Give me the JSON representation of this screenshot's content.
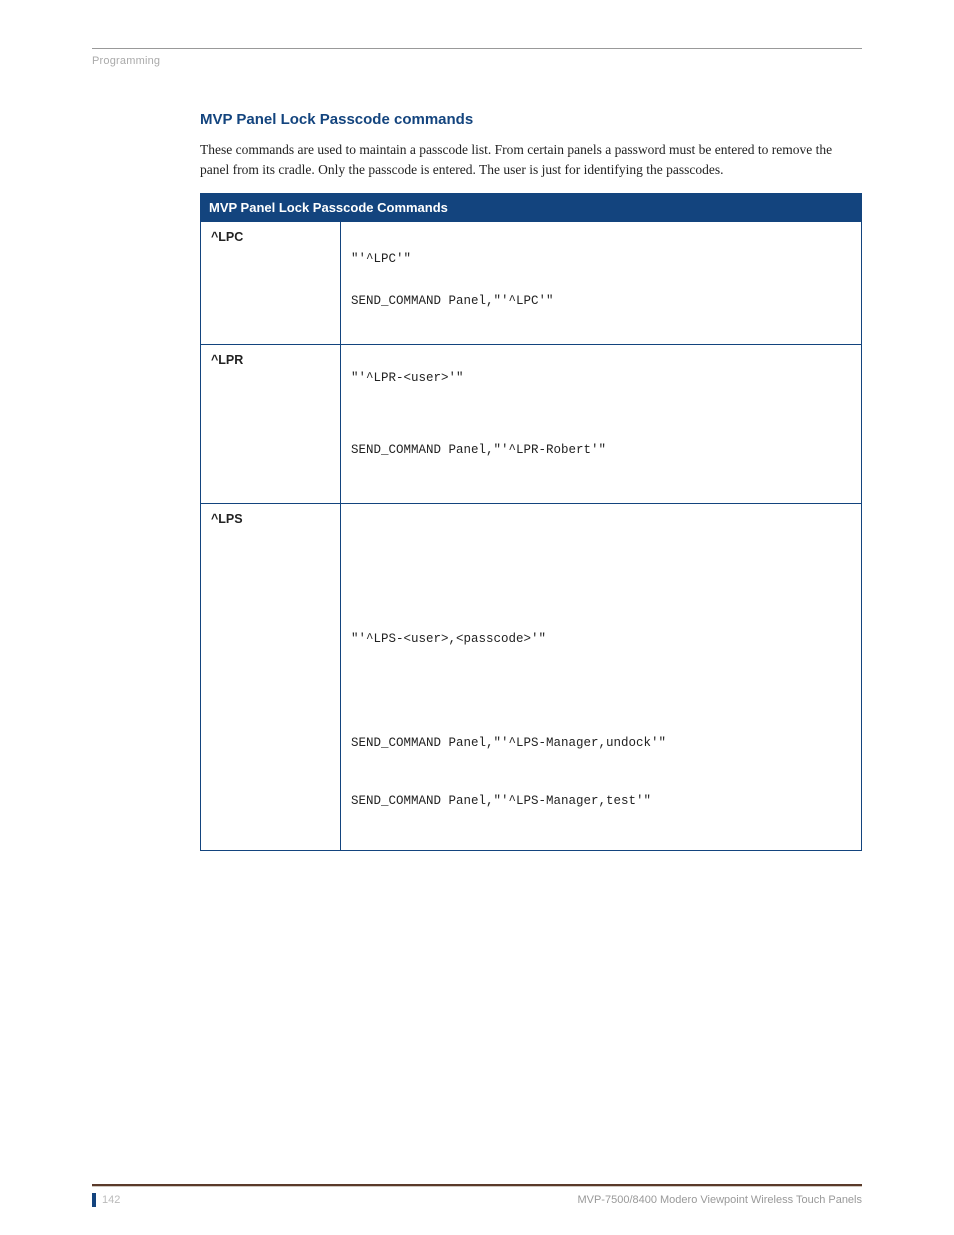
{
  "header": {
    "label": "Programming"
  },
  "section": {
    "heading": "MVP Panel Lock Passcode commands",
    "intro": "These commands are used to maintain a passcode list. From certain panels a password must be entered to remove the panel from its cradle. Only the passcode is entered. The user is just for identifying the passcodes."
  },
  "table": {
    "title": "MVP Panel Lock Passcode Commands",
    "rows": [
      {
        "cmd": "^LPC",
        "lines": [
          "\"'^LPC'\"",
          "SEND_COMMAND Panel,\"'^LPC'\""
        ]
      },
      {
        "cmd": "^LPR",
        "lines": [
          "\"'^LPR-<user>'\"",
          "SEND_COMMAND Panel,\"'^LPR-Robert'\""
        ]
      },
      {
        "cmd": "^LPS",
        "lines": [
          "\"'^LPS-<user>,<passcode>'\"",
          "SEND_COMMAND Panel,\"'^LPS-Manager,undock'\"",
          "SEND_COMMAND Panel,\"'^LPS-Manager,test'\""
        ]
      }
    ]
  },
  "footer": {
    "page": "142",
    "title": "MVP-7500/8400 Modero Viewpoint Wireless Touch Panels"
  }
}
